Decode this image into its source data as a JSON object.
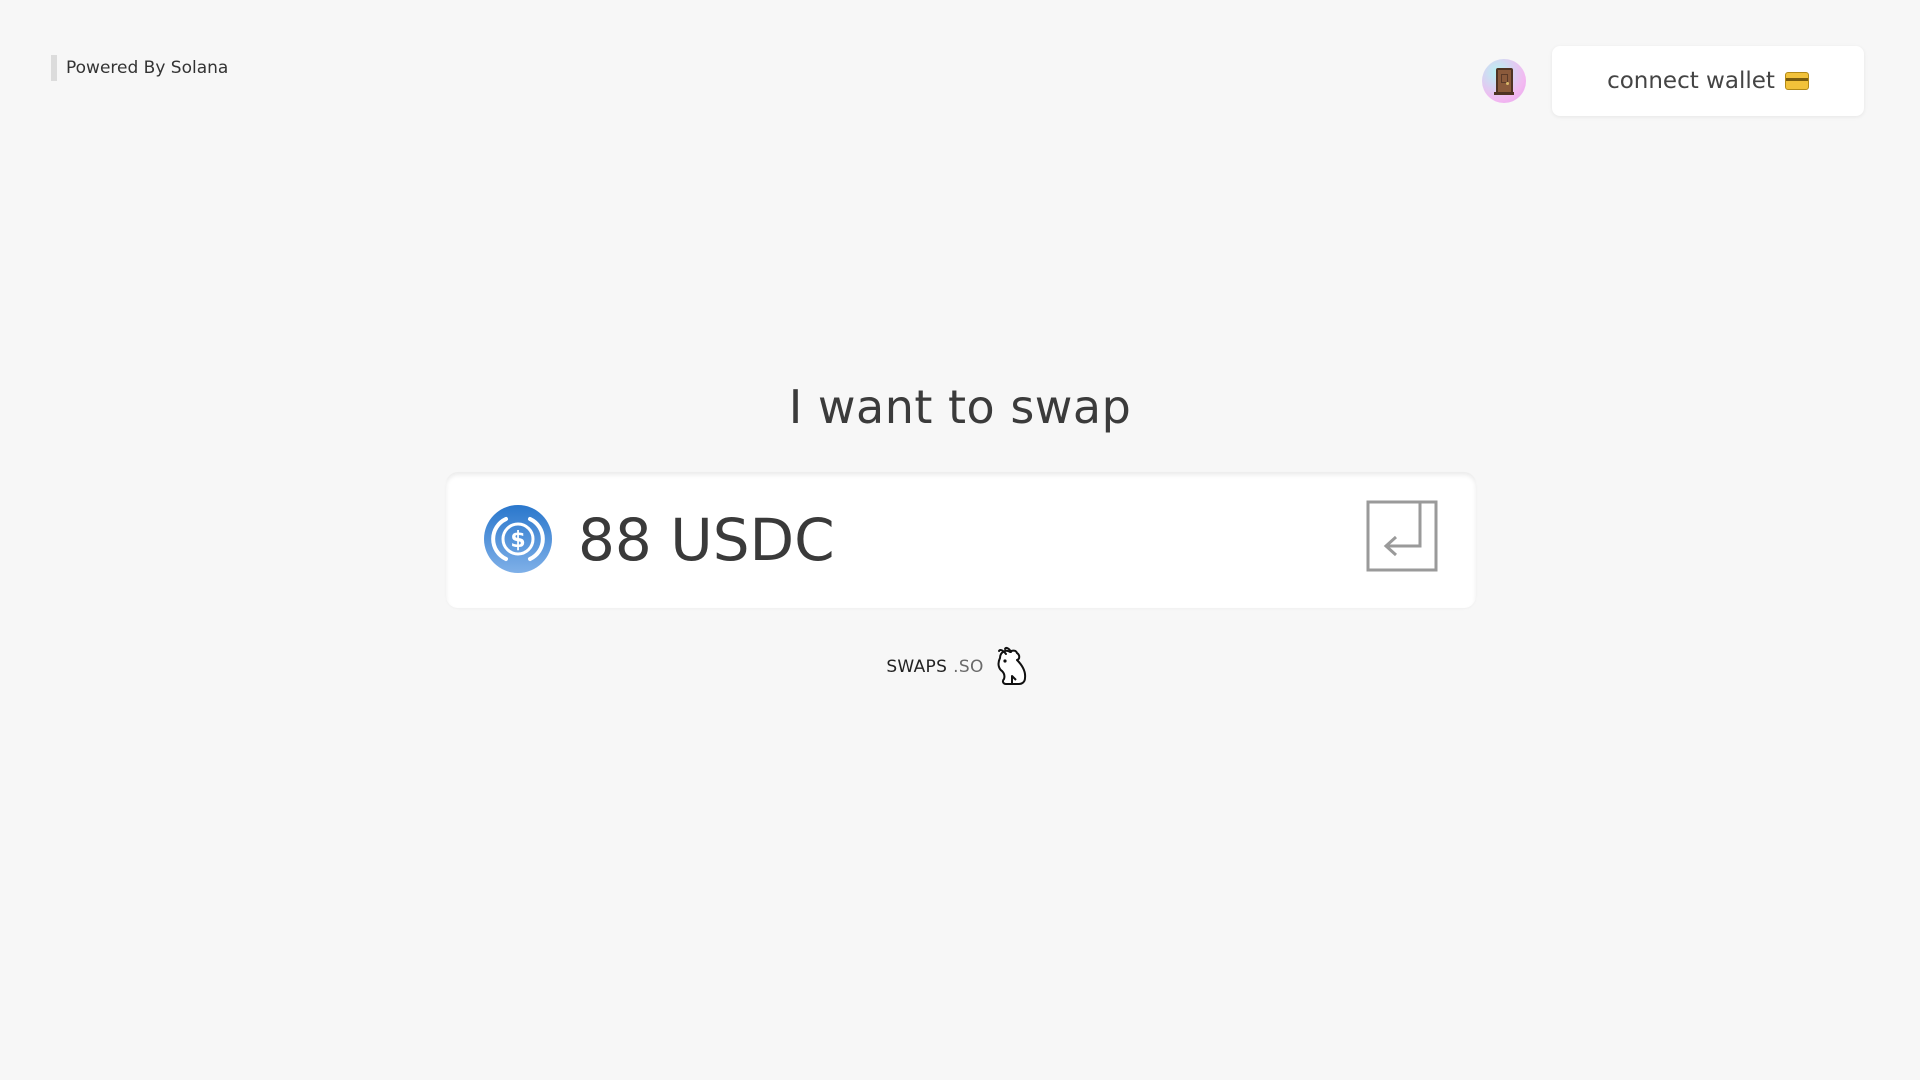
{
  "header": {
    "powered_by": "Powered By Solana",
    "connect_wallet_label": "connect wallet",
    "avatar_icon": "door-icon",
    "wallet_icon": "credit-card-icon"
  },
  "main": {
    "heading": "I want to swap",
    "swap_input": {
      "value": "88 USDC",
      "token_icon": "usdc-icon",
      "submit_icon": "enter-icon"
    }
  },
  "footer": {
    "brand_main": "SWAPS",
    "brand_suffix": ".SO",
    "brand_icon": "rabbit-icon"
  },
  "colors": {
    "background": "#f7f7f7",
    "usdc_blue": "#2775ca",
    "text": "#3a3a3a"
  }
}
